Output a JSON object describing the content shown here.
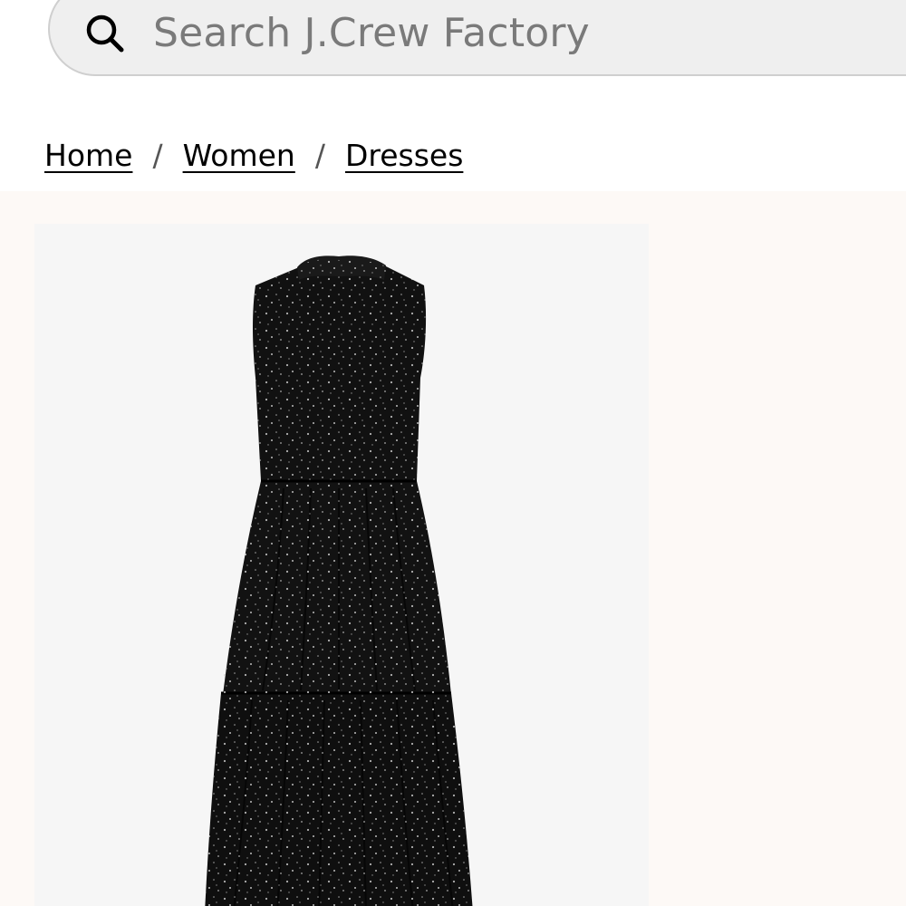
{
  "search": {
    "placeholder": "Search J.Crew Factory"
  },
  "breadcrumb": {
    "items": [
      "Home",
      "Women",
      "Dresses"
    ],
    "separator": "/"
  },
  "product": {
    "image_description_icon": "dress-image"
  },
  "colors": {
    "search_bg": "#efefef",
    "section_bg": "#fdf9f6",
    "image_bg": "#f6f6f6",
    "dress": "#111111"
  }
}
